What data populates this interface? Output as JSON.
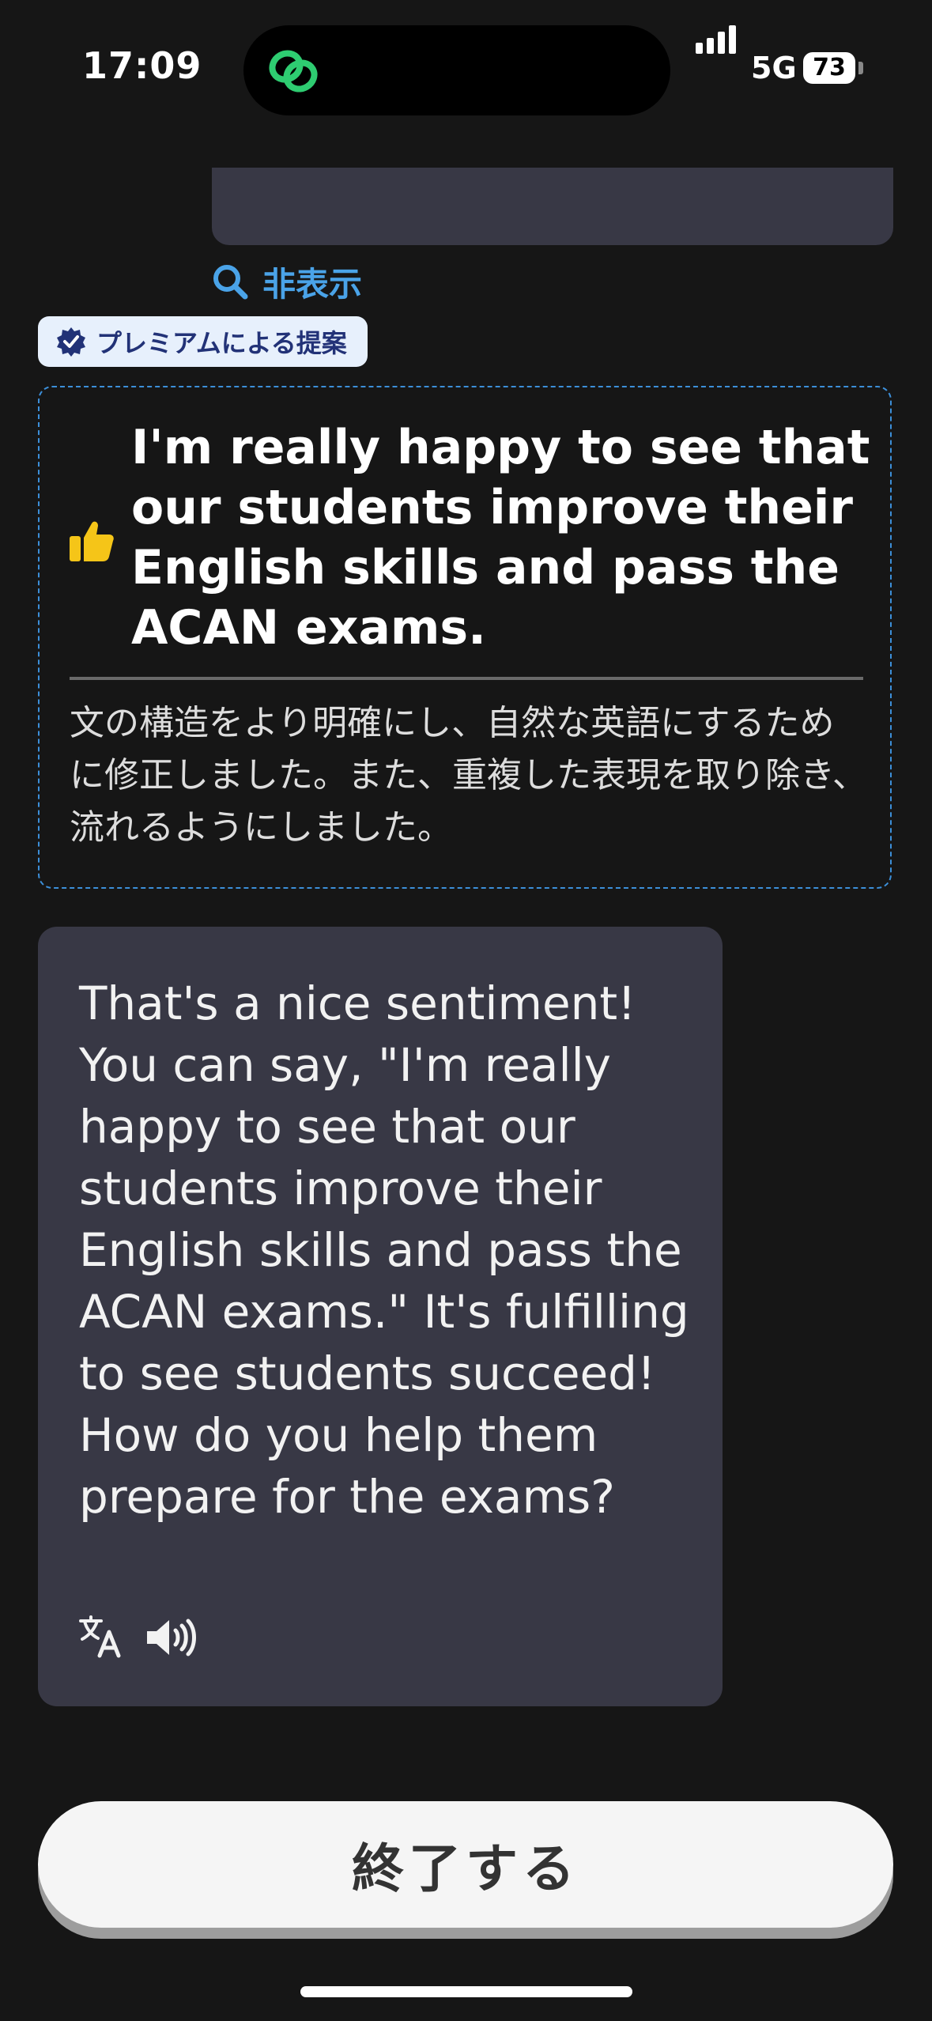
{
  "status_bar": {
    "time": "17:09",
    "network": "5G",
    "battery": "73",
    "icons": [
      "app-link-icon",
      "signal-icon",
      "battery-icon"
    ]
  },
  "feedback": {
    "hide_label": "非表示",
    "premium_badge": "プレミアムによる提案",
    "suggestion": "I'm really happy to see that our students improve their English skills and pass the ACAN exams.",
    "explanation": "文の構造をより明確にし、自然な英語にするために修正しました。また、重複した表現を取り除き、流れるようにしました。"
  },
  "ai_reply": {
    "text": "That's a nice sentiment! You can say, \"I'm really happy to see that our students improve their English skills and pass the ACAN exams.\" It's fulfilling to see students succeed! How do you help them prepare for the exams?"
  },
  "footer": {
    "finish_label": "終了する"
  },
  "colors": {
    "background": "#161616",
    "bubble": "#383845",
    "accent_blue": "#4aa3e8",
    "island_icon_green": "#2ecc71",
    "thumbs_yellow": "#f5c518"
  }
}
